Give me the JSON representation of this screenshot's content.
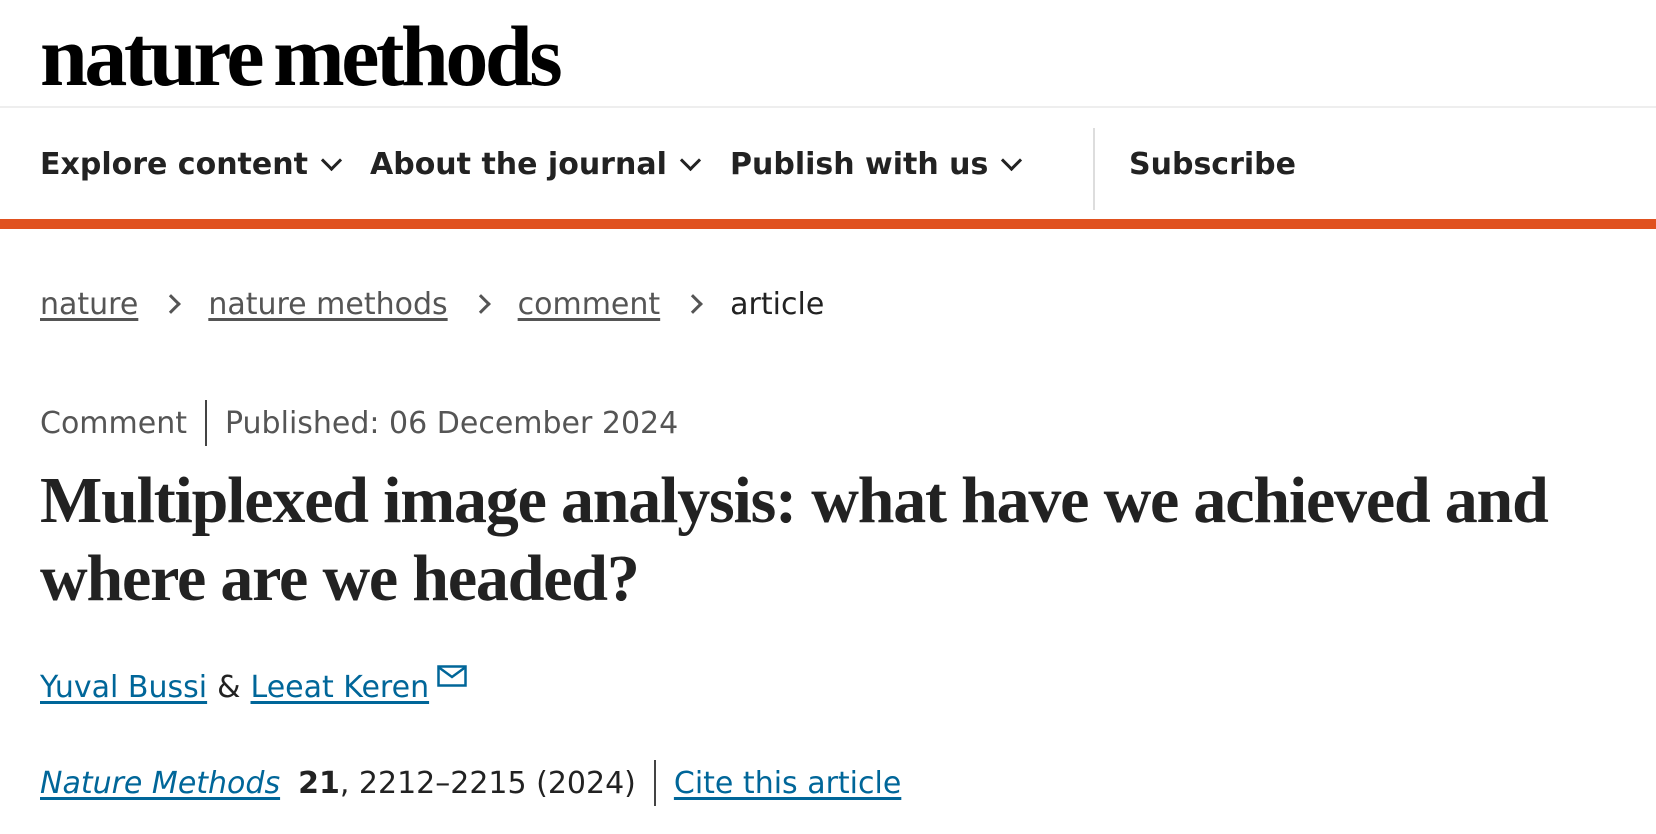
{
  "site": {
    "logo_text": "nature methods"
  },
  "nav": {
    "items": [
      {
        "label": "Explore content"
      },
      {
        "label": "About the journal"
      },
      {
        "label": "Publish with us"
      }
    ],
    "subscribe_label": "Subscribe"
  },
  "breadcrumb": {
    "items": [
      "nature",
      "nature methods",
      "comment"
    ],
    "current": "article"
  },
  "article": {
    "type": "Comment",
    "published": "Published: 06 December 2024",
    "title": "Multiplexed image analysis: what have we achieved and where are we headed?",
    "authors": [
      "Yuval Bussi",
      "Leeat Keren"
    ],
    "author_separator": "&",
    "journal": "Nature Methods",
    "volume": "21",
    "pages": ", 2212–2215 (2024)",
    "cite_label": "Cite this article"
  },
  "colors": {
    "accent": "#e0511f",
    "link": "#006699",
    "text": "#222222",
    "muted": "#555555"
  },
  "icons": {
    "nav_chevron": "chevron-down-icon",
    "breadcrumb_separator": "chevron-right-icon",
    "author_contact": "mail-icon"
  }
}
